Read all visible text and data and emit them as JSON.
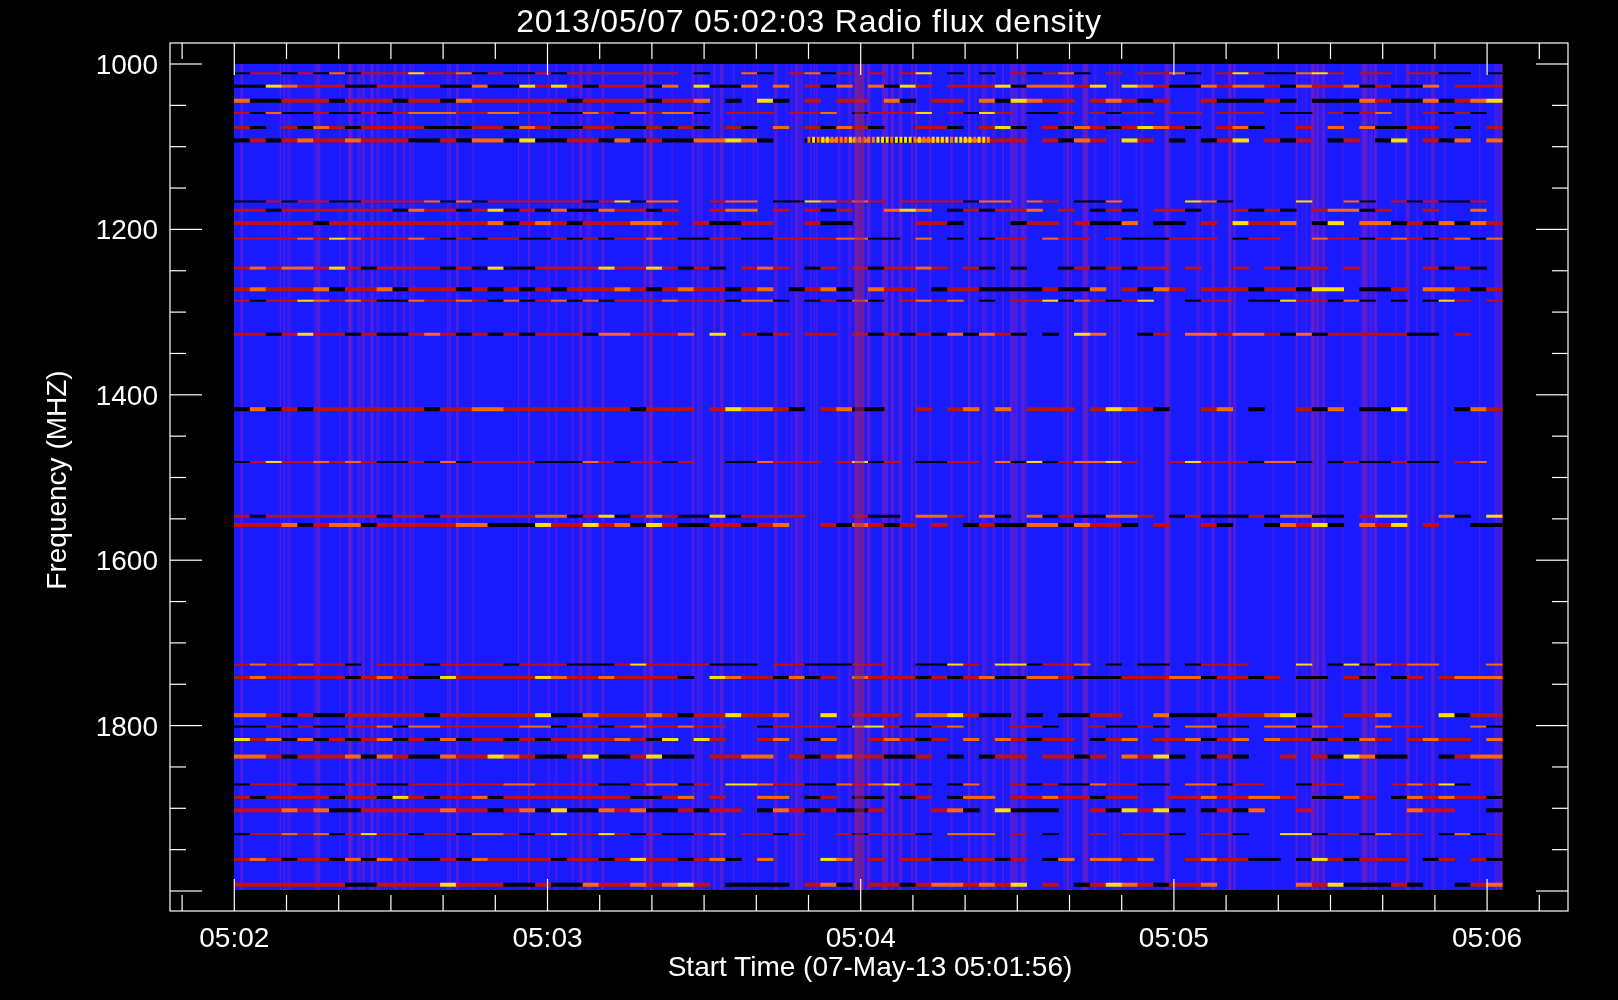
{
  "title": "2013/05/07 05:02:03 Radio flux density",
  "y_axis": {
    "label": "Frequency (MHZ)",
    "ticks": [
      "1000",
      "1200",
      "1400",
      "1600",
      "1800"
    ]
  },
  "x_axis": {
    "label": "Start Time (07-May-13 05:01:56)",
    "ticks": [
      "05:02",
      "05:03",
      "05:04",
      "05:05",
      "05:06"
    ]
  }
}
